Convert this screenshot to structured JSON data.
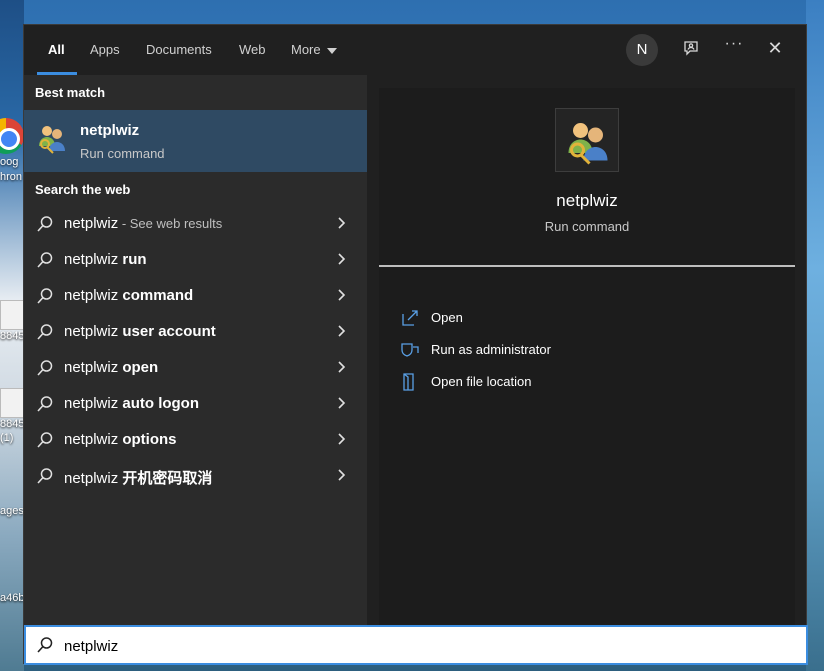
{
  "desktop": {
    "labels": [
      "oog",
      "hron",
      "8845",
      "8845",
      "(1)",
      "ages",
      "a46b"
    ]
  },
  "tabs": {
    "all": "All",
    "apps": "Apps",
    "documents": "Documents",
    "web": "Web",
    "more": "More"
  },
  "header": {
    "avatar_initial": "N",
    "more_options": "···",
    "close": "✕"
  },
  "best_match": {
    "heading": "Best match",
    "title": "netplwiz",
    "subtitle": "Run command"
  },
  "web_search": {
    "heading": "Search the web",
    "items": [
      {
        "prefix": "netplwiz",
        "bold": "",
        "hint": " - See web results"
      },
      {
        "prefix": "netplwiz ",
        "bold": "run",
        "hint": ""
      },
      {
        "prefix": "netplwiz ",
        "bold": "command",
        "hint": ""
      },
      {
        "prefix": "netplwiz ",
        "bold": "user account",
        "hint": ""
      },
      {
        "prefix": "netplwiz ",
        "bold": "open",
        "hint": ""
      },
      {
        "prefix": "netplwiz ",
        "bold": "auto logon",
        "hint": ""
      },
      {
        "prefix": "netplwiz ",
        "bold": "options",
        "hint": ""
      },
      {
        "prefix": "netplwiz ",
        "bold": "开机密码取消",
        "hint": ""
      }
    ]
  },
  "detail": {
    "name": "netplwiz",
    "type": "Run command",
    "actions": [
      {
        "label": "Open",
        "icon": "open-icon"
      },
      {
        "label": "Run as administrator",
        "icon": "shield-icon"
      },
      {
        "label": "Open file location",
        "icon": "file-location-icon"
      }
    ]
  },
  "search": {
    "value": "netplwiz",
    "icon": "search-icon"
  },
  "colors": {
    "accent": "#3b8de0",
    "window_bg": "#202020",
    "left_pane_bg": "#2b2b2b",
    "selected_bg": "#2f4a63"
  }
}
